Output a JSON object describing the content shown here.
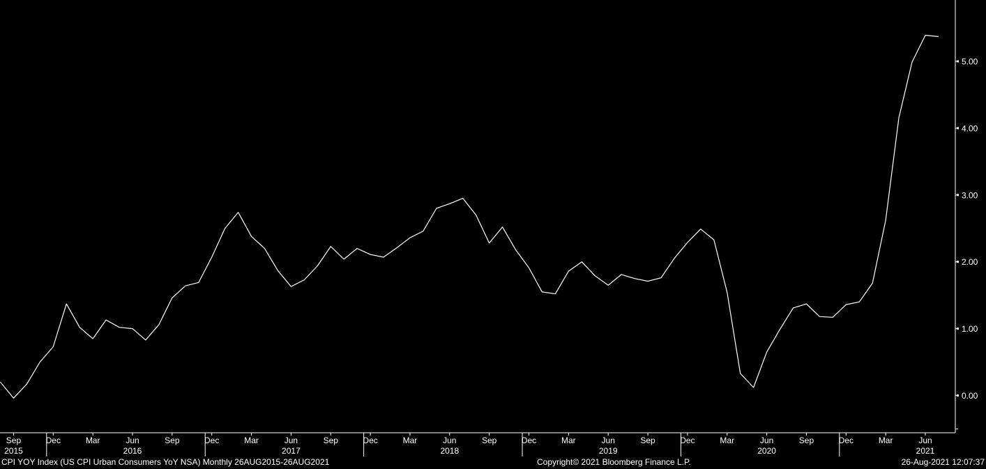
{
  "chart_data": {
    "type": "line",
    "ylim": [
      -0.5,
      5.8
    ],
    "y_ticks": [
      "0.00",
      "1.00",
      "2.00",
      "3.00",
      "4.00",
      "5.00"
    ],
    "y_tick_values": [
      0,
      1,
      2,
      3,
      4,
      5
    ],
    "grid": false,
    "x_month_ticks": [
      {
        "label": "Sep",
        "index": 0
      },
      {
        "label": "Dec",
        "index": 3
      },
      {
        "label": "Mar",
        "index": 6
      },
      {
        "label": "Jun",
        "index": 9
      },
      {
        "label": "Sep",
        "index": 12
      },
      {
        "label": "Dec",
        "index": 15
      },
      {
        "label": "Mar",
        "index": 18
      },
      {
        "label": "Jun",
        "index": 21
      },
      {
        "label": "Sep",
        "index": 24
      },
      {
        "label": "Dec",
        "index": 27
      },
      {
        "label": "Mar",
        "index": 30
      },
      {
        "label": "Jun",
        "index": 33
      },
      {
        "label": "Sep",
        "index": 36
      },
      {
        "label": "Dec",
        "index": 39
      },
      {
        "label": "Mar",
        "index": 42
      },
      {
        "label": "Jun",
        "index": 45
      },
      {
        "label": "Sep",
        "index": 48
      },
      {
        "label": "Dec",
        "index": 51
      },
      {
        "label": "Mar",
        "index": 54
      },
      {
        "label": "Jun",
        "index": 57
      },
      {
        "label": "Sep",
        "index": 60
      },
      {
        "label": "Dec",
        "index": 63
      },
      {
        "label": "Mar",
        "index": 66
      },
      {
        "label": "Jun",
        "index": 69
      }
    ],
    "x_year_labels": [
      {
        "label": "2015",
        "index": 0
      },
      {
        "label": "2016",
        "index": 9
      },
      {
        "label": "2017",
        "index": 21
      },
      {
        "label": "2018",
        "index": 33
      },
      {
        "label": "2019",
        "index": 45
      },
      {
        "label": "2020",
        "index": 57
      },
      {
        "label": "2021",
        "index": 69
      }
    ],
    "x_year_boundaries": [
      2.5,
      14.5,
      26.5,
      38.5,
      50.5,
      62.5
    ],
    "series": [
      {
        "x": [
          "2015-08",
          "2015-09",
          "2015-10",
          "2015-11",
          "2015-12",
          "2016-01",
          "2016-02",
          "2016-03",
          "2016-04",
          "2016-05",
          "2016-06",
          "2016-07",
          "2016-08",
          "2016-09",
          "2016-10",
          "2016-11",
          "2016-12",
          "2017-01",
          "2017-02",
          "2017-03",
          "2017-04",
          "2017-05",
          "2017-06",
          "2017-07",
          "2017-08",
          "2017-09",
          "2017-10",
          "2017-11",
          "2017-12",
          "2018-01",
          "2018-02",
          "2018-03",
          "2018-04",
          "2018-05",
          "2018-06",
          "2018-07",
          "2018-08",
          "2018-09",
          "2018-10",
          "2018-11",
          "2018-12",
          "2019-01",
          "2019-02",
          "2019-03",
          "2019-04",
          "2019-05",
          "2019-06",
          "2019-07",
          "2019-08",
          "2019-09",
          "2019-10",
          "2019-11",
          "2019-12",
          "2020-01",
          "2020-02",
          "2020-03",
          "2020-04",
          "2020-05",
          "2020-06",
          "2020-07",
          "2020-08",
          "2020-09",
          "2020-10",
          "2020-11",
          "2020-12",
          "2021-01",
          "2021-02",
          "2021-03",
          "2021-04",
          "2021-05",
          "2021-06",
          "2021-07"
        ],
        "values": [
          0.2,
          -0.04,
          0.17,
          0.5,
          0.73,
          1.37,
          1.02,
          0.85,
          1.13,
          1.02,
          1.0,
          0.83,
          1.06,
          1.46,
          1.64,
          1.69,
          2.07,
          2.5,
          2.74,
          2.38,
          2.2,
          1.87,
          1.63,
          1.73,
          1.94,
          2.23,
          2.04,
          2.2,
          2.11,
          2.07,
          2.21,
          2.36,
          2.46,
          2.8,
          2.87,
          2.95,
          2.7,
          2.28,
          2.52,
          2.18,
          1.91,
          1.55,
          1.52,
          1.86,
          2.0,
          1.79,
          1.65,
          1.81,
          1.75,
          1.71,
          1.76,
          2.05,
          2.29,
          2.49,
          2.33,
          1.54,
          0.33,
          0.12,
          0.65,
          0.99,
          1.31,
          1.37,
          1.18,
          1.17,
          1.36,
          1.4,
          1.68,
          2.62,
          4.16,
          4.99,
          5.39,
          5.37
        ]
      }
    ]
  },
  "footer": {
    "description": "CPI YOY Index (US CPI Urban Consumers YoY NSA)  Monthly 26AUG2015-26AUG2021",
    "copyright": "Copyright© 2021 Bloomberg Finance L.P.",
    "timestamp": "26-Aug-2021 12:07:37"
  }
}
